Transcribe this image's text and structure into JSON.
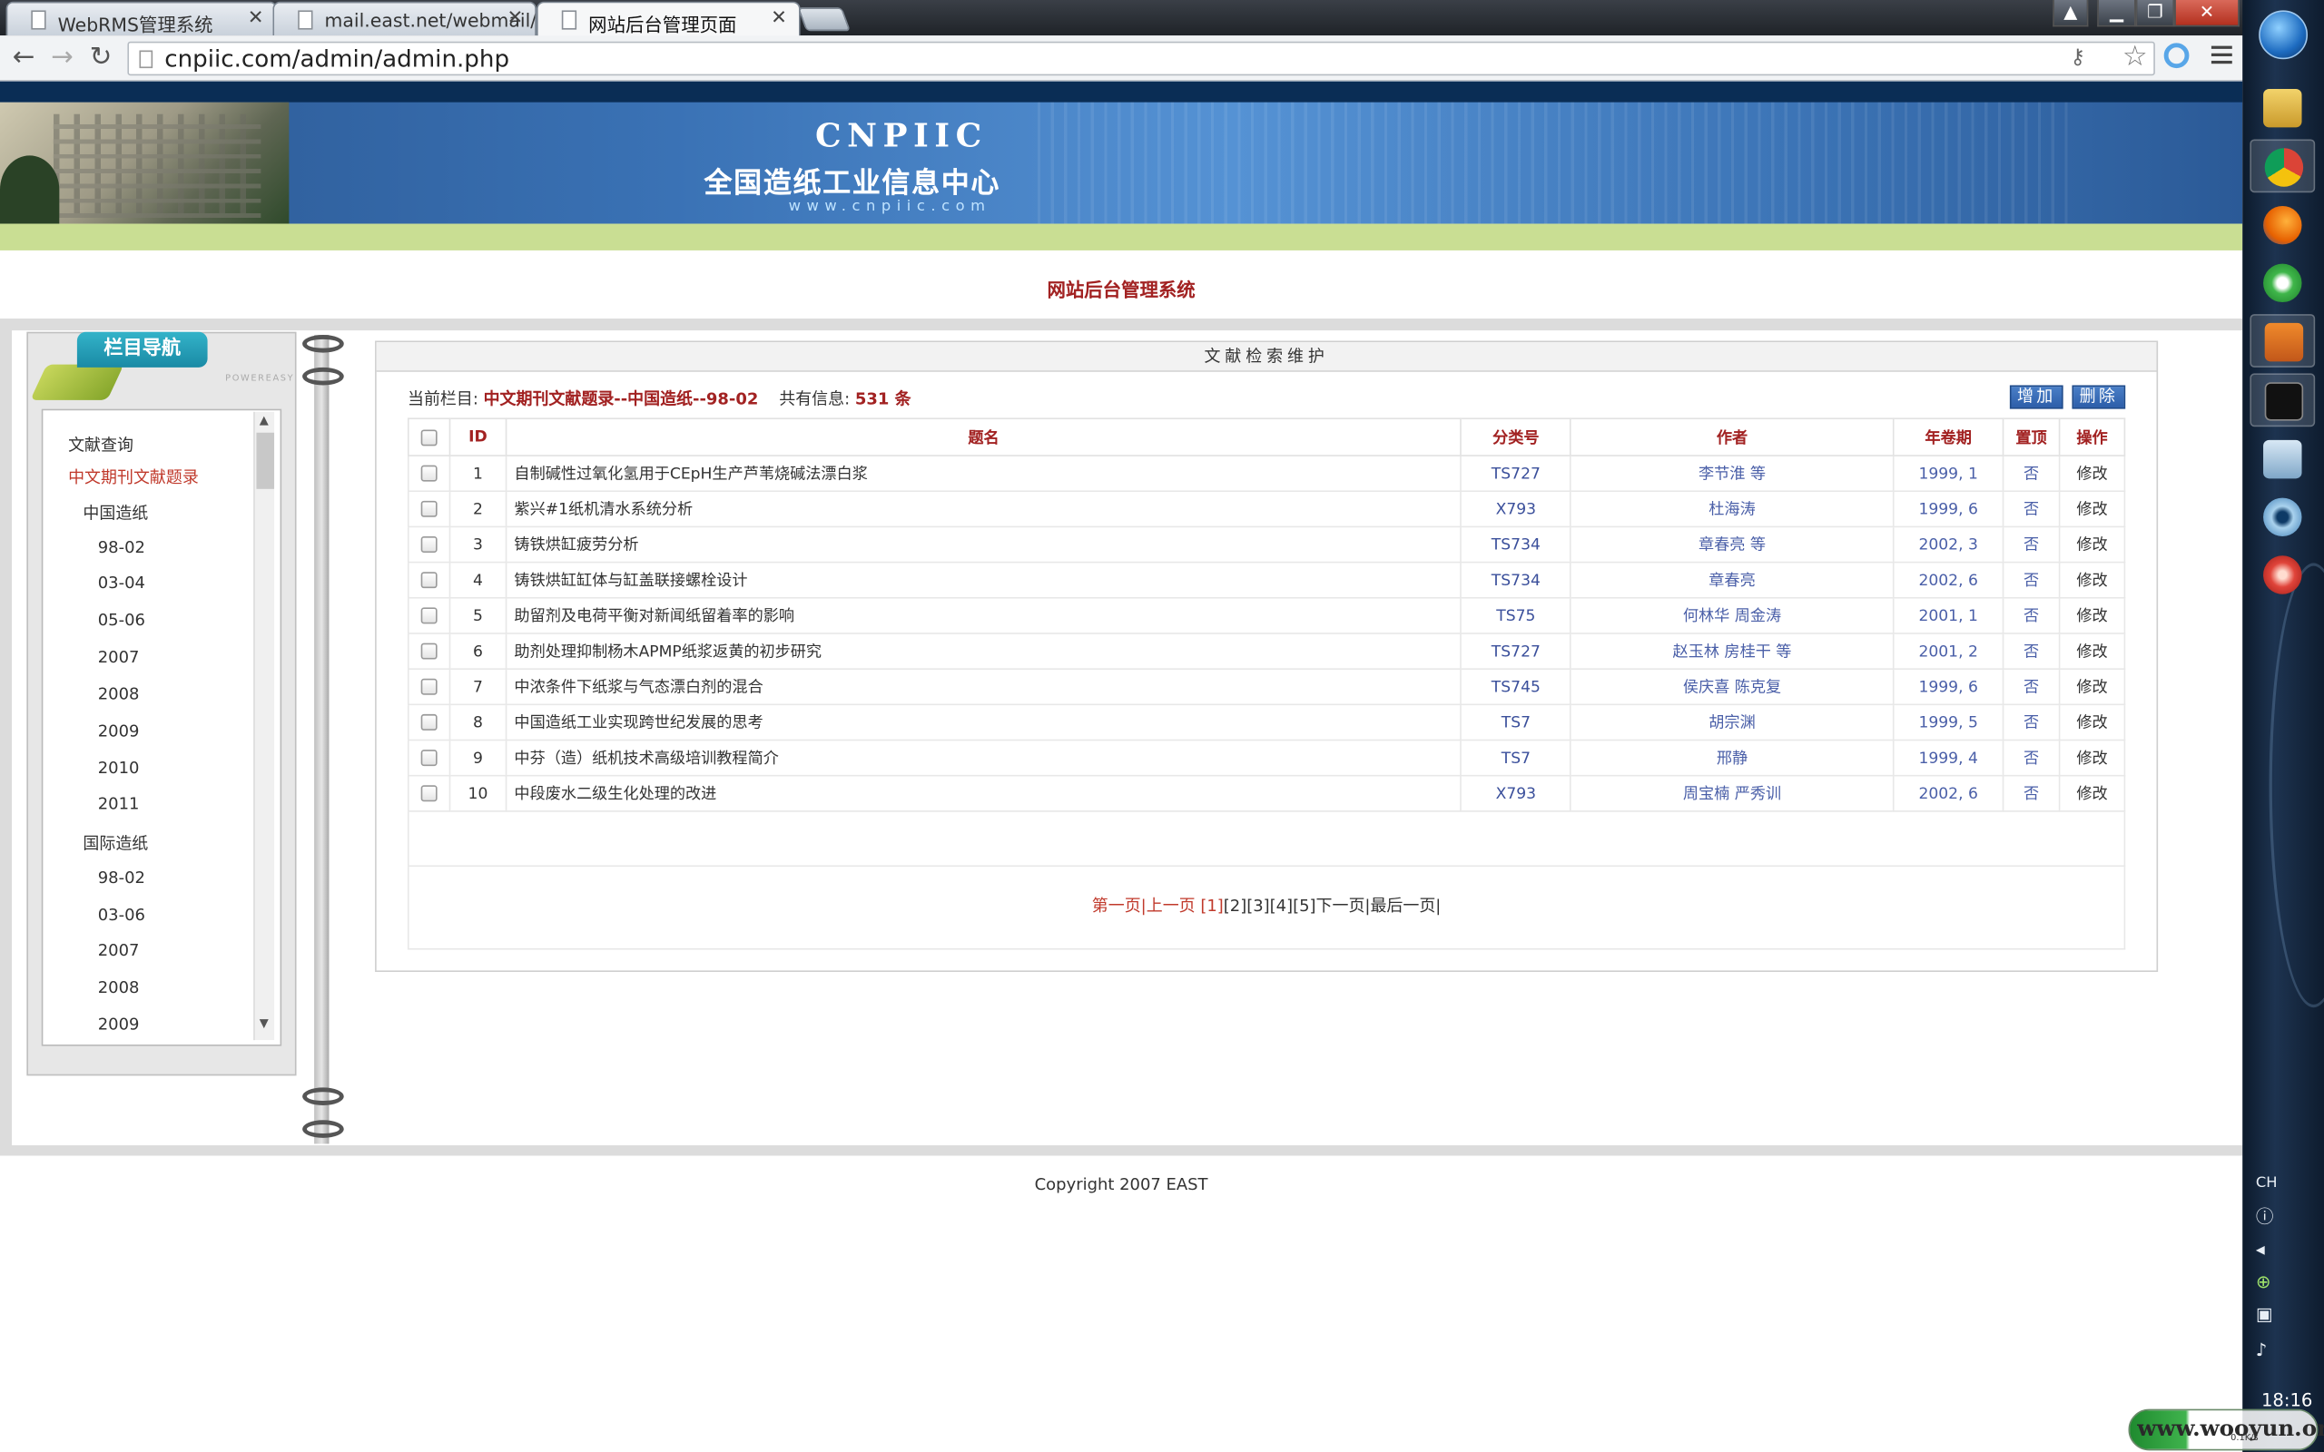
{
  "browser": {
    "tabs": [
      {
        "label": "WebRMS管理系统"
      },
      {
        "label": "mail.east.net/webmail/"
      },
      {
        "label": "网站后台管理页面"
      }
    ],
    "url": "cnpiic.com/admin/admin.php"
  },
  "header": {
    "logo_en": "CNPIIC",
    "logo_cn": "全国造纸工业信息中心",
    "logo_url": "www.cnpiic.com",
    "system_title": "网站后台管理系统"
  },
  "nav": {
    "heading": "栏目导航",
    "powered": "POWEREASY",
    "items": [
      {
        "label": "文献查询",
        "level": 1
      },
      {
        "label": "中文期刊文献题录",
        "level": 1,
        "active": true
      },
      {
        "label": "中国造纸",
        "level": 2
      },
      {
        "label": "98-02",
        "level": 3
      },
      {
        "label": "03-04",
        "level": 3
      },
      {
        "label": "05-06",
        "level": 3
      },
      {
        "label": "2007",
        "level": 3
      },
      {
        "label": "2008",
        "level": 3
      },
      {
        "label": "2009",
        "level": 3
      },
      {
        "label": "2010",
        "level": 3
      },
      {
        "label": "2011",
        "level": 3
      },
      {
        "label": "国际造纸",
        "level": 2
      },
      {
        "label": "98-02",
        "level": 3
      },
      {
        "label": "03-06",
        "level": 3
      },
      {
        "label": "2007",
        "level": 3
      },
      {
        "label": "2008",
        "level": 3
      },
      {
        "label": "2009",
        "level": 3
      }
    ]
  },
  "main": {
    "panel_title": "文献检索维护",
    "current_label": "当前栏目:",
    "current_value": "中文期刊文献题录--中国造纸--98-02",
    "total_label": "共有信息:",
    "total_value": "531 条",
    "add_button": "增加",
    "delete_button": "删除",
    "columns": [
      "ID",
      "题名",
      "分类号",
      "作者",
      "年卷期",
      "置顶",
      "操作"
    ],
    "rows": [
      {
        "id": "1",
        "title": "自制碱性过氧化氢用于CEpH生产芦苇烧碱法漂白浆",
        "cls": "TS727",
        "author": "李节淮 等",
        "issue": "1999, 1",
        "top": "否",
        "op": "修改"
      },
      {
        "id": "2",
        "title": "紫兴#1纸机清水系统分析",
        "cls": "X793",
        "author": "杜海涛",
        "issue": "1999, 6",
        "top": "否",
        "op": "修改"
      },
      {
        "id": "3",
        "title": "铸铁烘缸疲劳分析",
        "cls": "TS734",
        "author": "章春亮 等",
        "issue": "2002, 3",
        "top": "否",
        "op": "修改"
      },
      {
        "id": "4",
        "title": "铸铁烘缸缸体与缸盖联接螺栓设计",
        "cls": "TS734",
        "author": "章春亮",
        "issue": "2002, 6",
        "top": "否",
        "op": "修改"
      },
      {
        "id": "5",
        "title": "助留剂及电荷平衡对新闻纸留着率的影响",
        "cls": "TS75",
        "author": "何林华 周金涛",
        "issue": "2001, 1",
        "top": "否",
        "op": "修改"
      },
      {
        "id": "6",
        "title": "助剂处理抑制杨木APMP纸浆返黄的初步研究",
        "cls": "TS727",
        "author": "赵玉林 房桂干 等",
        "issue": "2001, 2",
        "top": "否",
        "op": "修改"
      },
      {
        "id": "7",
        "title": "中浓条件下纸浆与气态漂白剂的混合",
        "cls": "TS745",
        "author": "侯庆喜 陈克复",
        "issue": "1999, 6",
        "top": "否",
        "op": "修改"
      },
      {
        "id": "8",
        "title": "中国造纸工业实现跨世纪发展的思考",
        "cls": "TS7",
        "author": "胡宗渊",
        "issue": "1999, 5",
        "top": "否",
        "op": "修改"
      },
      {
        "id": "9",
        "title": "中芬（造）纸机技术高级培训教程简介",
        "cls": "TS7",
        "author": "邢静",
        "issue": "1999, 4",
        "top": "否",
        "op": "修改"
      },
      {
        "id": "10",
        "title": "中段废水二级生化处理的改进",
        "cls": "X793",
        "author": "周宝楠 严秀训",
        "issue": "2002, 6",
        "top": "否",
        "op": "修改"
      }
    ],
    "pager": {
      "first_prev": "第一页|上一页 [1]",
      "pages": "[2][3][4][5]",
      "next_last": "下一页|最后一页|"
    }
  },
  "footer": {
    "copyright": "Copyright 2007 EAST"
  },
  "system": {
    "clock": "18:16",
    "ime": "CH",
    "watermark": "www.wooyun.org",
    "net_speed": "0.1K/s"
  }
}
